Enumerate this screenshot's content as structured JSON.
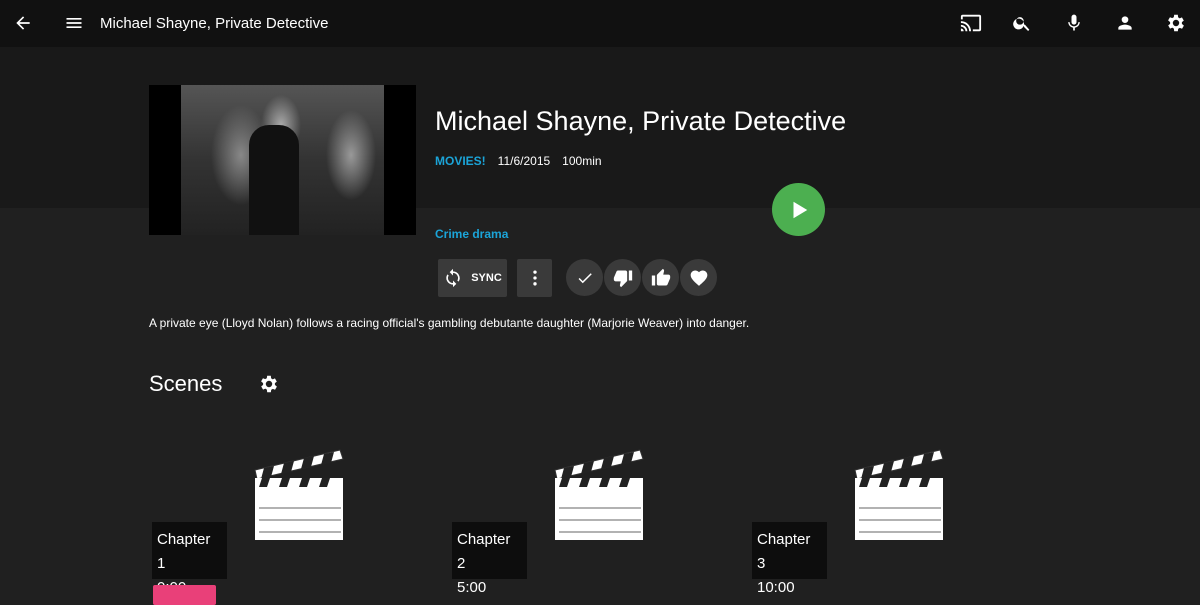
{
  "header": {
    "title": "Michael Shayne, Private Detective"
  },
  "movie": {
    "title": "Michael Shayne, Private Detective",
    "channel": "MOVIES!",
    "date": "11/6/2015",
    "duration": "100min",
    "genre": "Crime drama",
    "description": "A private eye (Lloyd Nolan) follows a racing official's gambling debutante daughter (Marjorie Weaver) into danger."
  },
  "actions": {
    "sync_label": "SYNC"
  },
  "scenes": {
    "heading": "Scenes",
    "items": [
      {
        "label": "Chapter 1",
        "time": "0:00"
      },
      {
        "label": "Chapter 2",
        "time": "5:00"
      },
      {
        "label": "Chapter 3",
        "time": "10:00"
      }
    ]
  },
  "colors": {
    "accent": "#1ba4d8",
    "play": "#4caf50",
    "record": "#e94079"
  }
}
